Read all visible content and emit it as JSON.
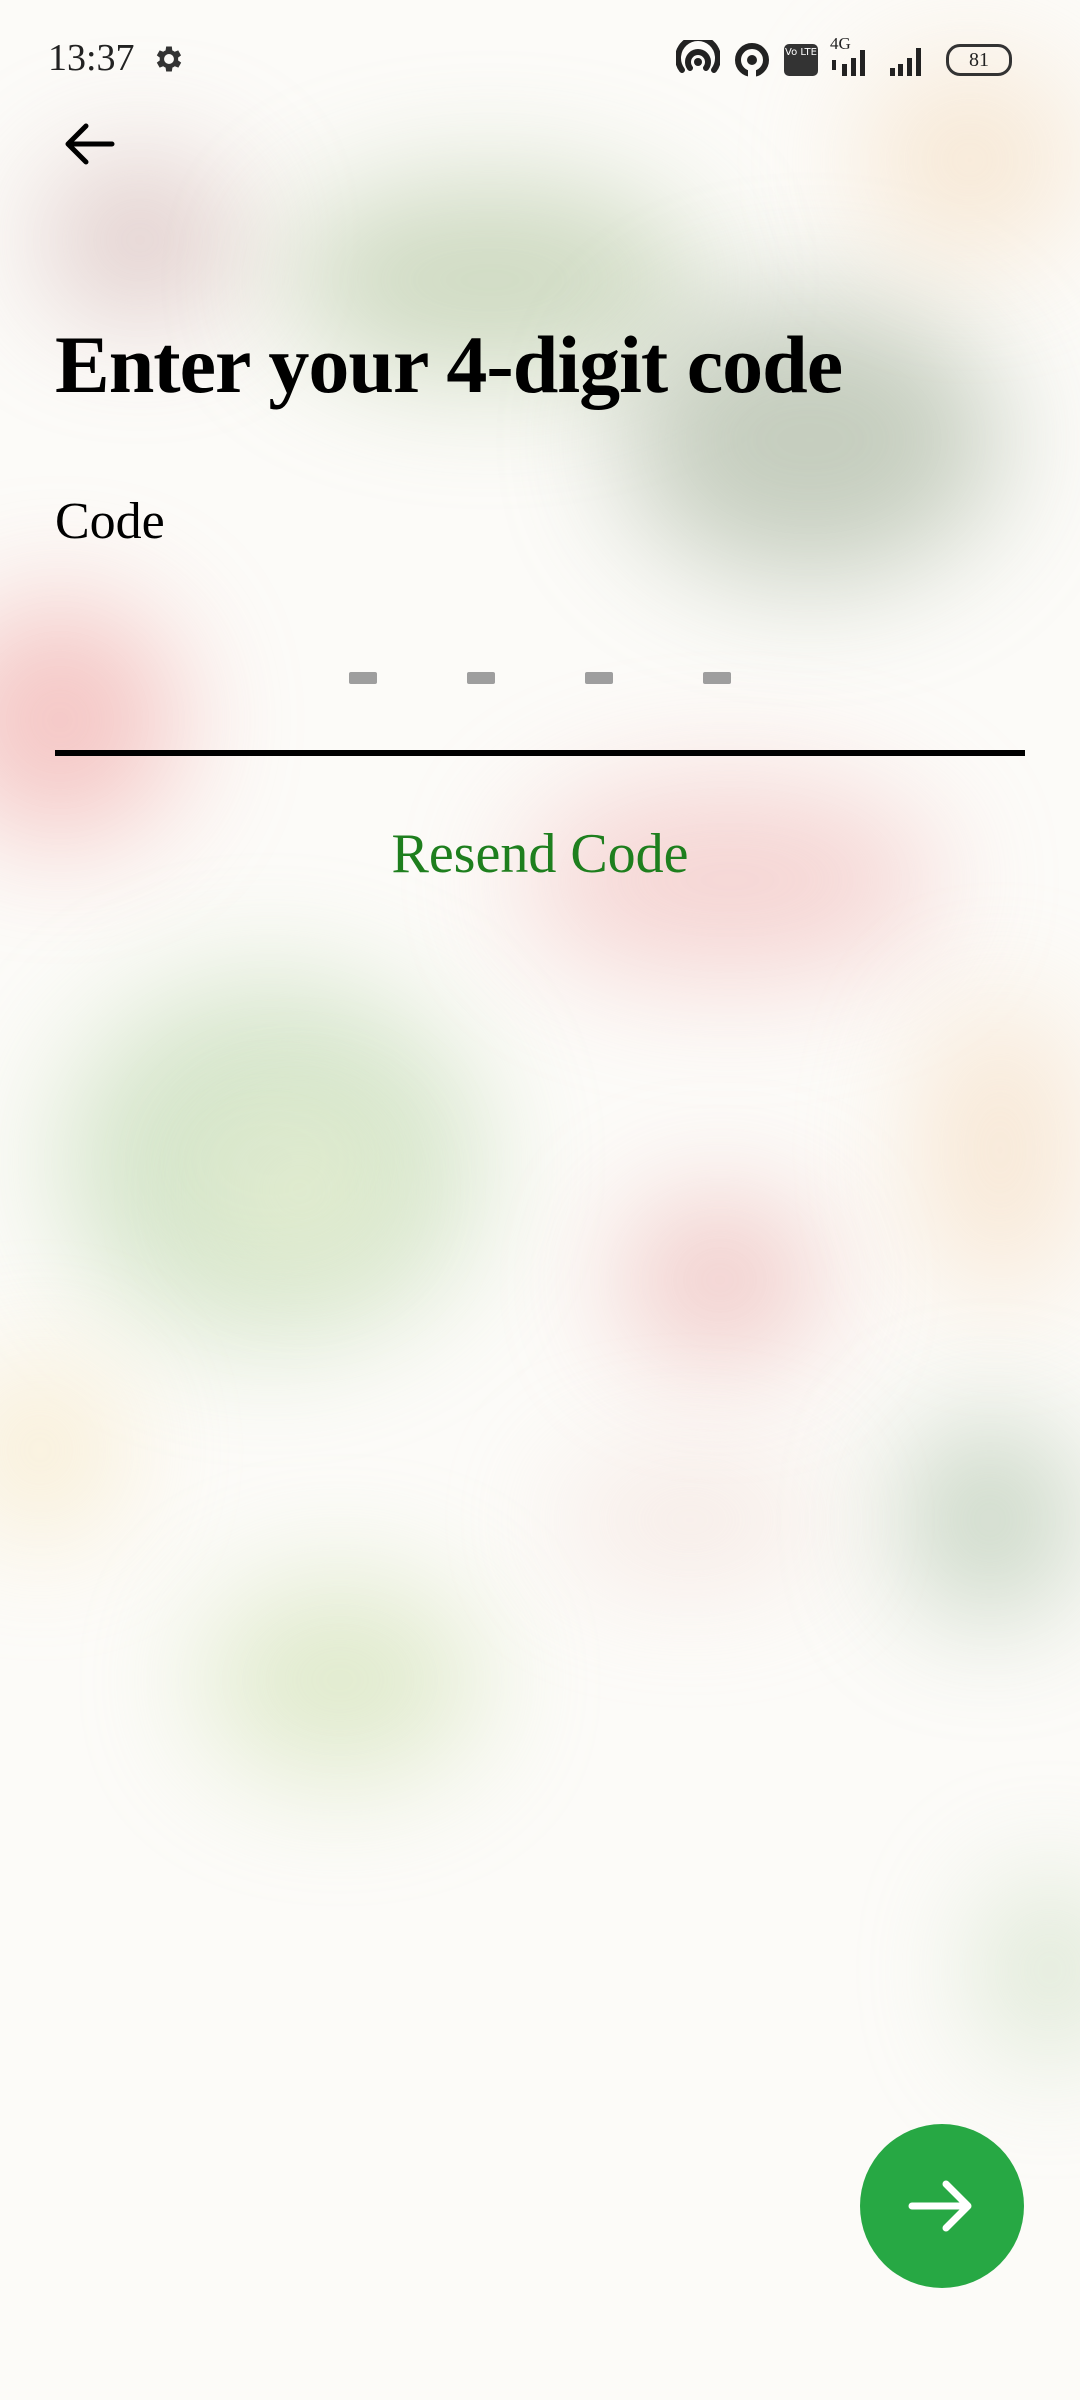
{
  "status_bar": {
    "time": "13:37",
    "network_label": "4G",
    "volte_label": "Vo LTE",
    "battery_level": "81",
    "icons": [
      "gear-icon",
      "hotspot-icon",
      "data-saver-icon",
      "volte-icon",
      "signal-icon",
      "signal-icon",
      "battery-icon"
    ]
  },
  "header": {
    "back_icon": "arrow-left-icon"
  },
  "page": {
    "title": "Enter your 4-digit code",
    "code_label": "Code",
    "code_placeholder_slots": 4,
    "resend_label": "Resend Code",
    "next_icon": "arrow-right-icon"
  },
  "colors": {
    "accent_green": "#27a844",
    "link_green": "#1e7f1e",
    "placeholder_gray": "#9e9e9e"
  }
}
